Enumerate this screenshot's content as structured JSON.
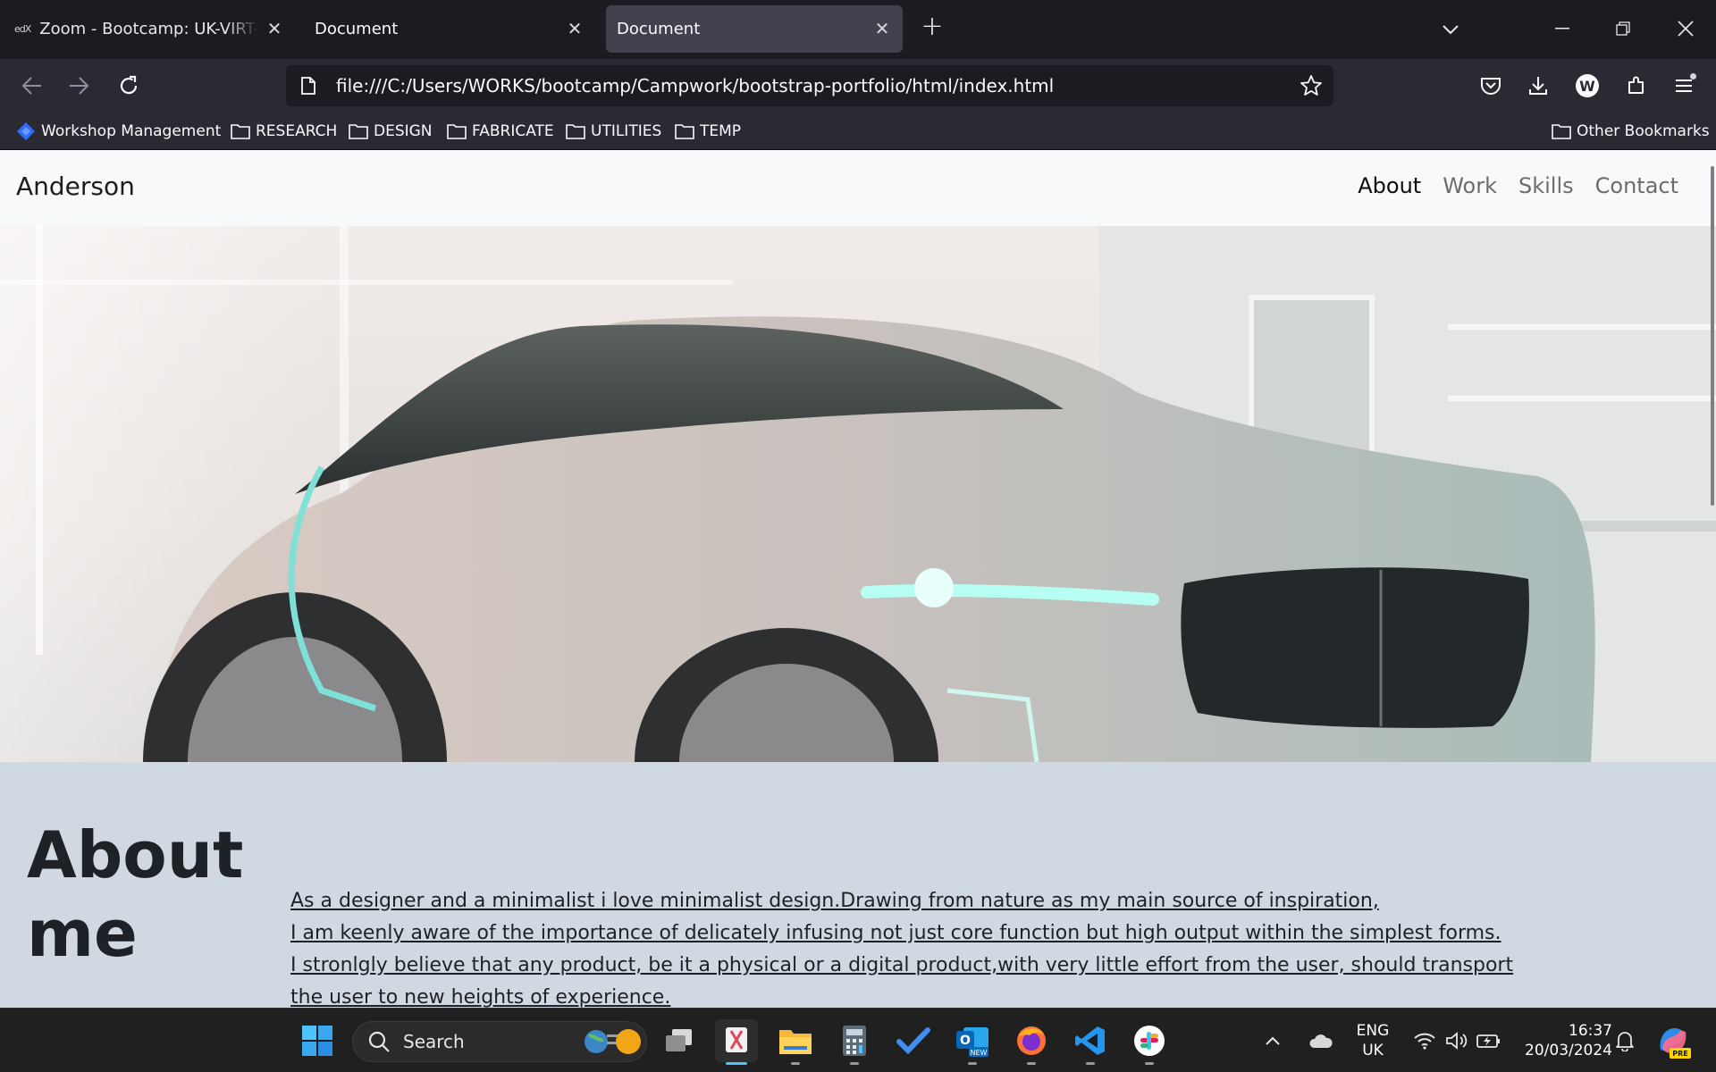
{
  "browser": {
    "tabs": [
      {
        "label": "Zoom - Bootcamp: UK-VIRT-FE",
        "favicon": "edx-logo",
        "active": false
      },
      {
        "label": "Document",
        "active": false
      },
      {
        "label": "Document",
        "active": true
      }
    ],
    "url": "file:///C:/Users/WORKS/bootcamp/Campwork/bootstrap-portfolio/html/index.html",
    "bookmarks": [
      {
        "label": "Workshop Management",
        "icon": "diamond-icon"
      },
      {
        "label": "RESEARCH",
        "icon": "folder-icon"
      },
      {
        "label": "DESIGN",
        "icon": "folder-icon"
      },
      {
        "label": "FABRICATE",
        "icon": "folder-icon"
      },
      {
        "label": "UTILITIES",
        "icon": "folder-icon"
      },
      {
        "label": "TEMP",
        "icon": "folder-icon"
      }
    ],
    "other_bookmarks": "Other Bookmarks",
    "account_badge": "W"
  },
  "site": {
    "brand": "Anderson",
    "nav": [
      {
        "label": "About",
        "active": true
      },
      {
        "label": "Work",
        "active": false
      },
      {
        "label": "Skills",
        "active": false
      },
      {
        "label": "Contact",
        "active": false
      }
    ],
    "hero_image": "concept-car-in-white-kitchen",
    "about": {
      "title": "About me",
      "lines": [
        "As a designer and a minimalist i love minimalist design.Drawing from nature as my main source of inspiration,",
        "I am keenly aware of the importance of delicately infusing not just core function but high output within the simplest forms.",
        "I stronlgly believe that any product, be it a physical or a digital product,with very little effort from the user, should transport",
        "the user to new heights of experience."
      ]
    }
  },
  "taskbar": {
    "search_label": "Search",
    "apps": [
      "windows-start-icon",
      "task-view-icon",
      "snipping-tool-icon",
      "file-explorer-icon",
      "calculator-icon",
      "todo-icon",
      "outlook-icon",
      "firefox-icon",
      "vscode-icon",
      "slack-icon"
    ],
    "language": "ENG",
    "region": "UK",
    "time": "16:37",
    "date": "20/03/2024",
    "outlook_badge": "NEW",
    "copilot_badge": "PRE"
  },
  "colors": {
    "tab_bg": "#1c1b22",
    "toolbar_bg": "#2b2a33",
    "site_nav_bg": "#f8f9fa",
    "about_bg": "#d0d9e1",
    "taskbar_bg": "#202020",
    "accent": "#4cc2ff"
  }
}
